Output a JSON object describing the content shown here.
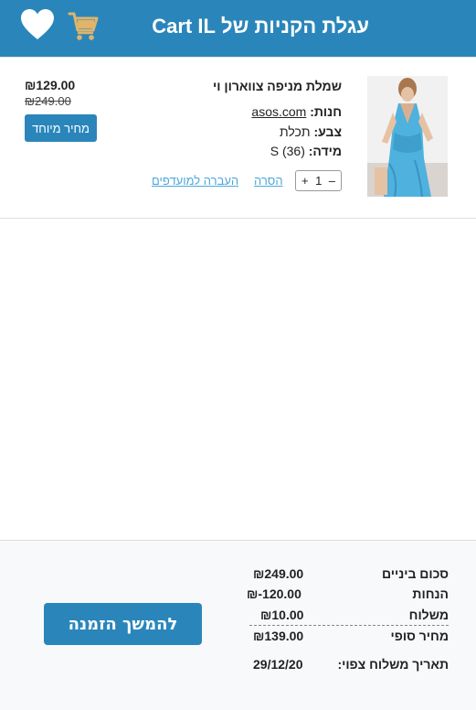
{
  "header": {
    "title": "עגלת הקניות של Cart IL",
    "heart_icon": "heart-icon",
    "cart_icon": "shopping-cart-icon",
    "background_color": "#2a86ba",
    "cart_icon_color": "#e0b46a"
  },
  "cart_item": {
    "name": "שמלת מניפה צווארון וי",
    "store_label": "חנות:",
    "store_value": "asos.com",
    "color_label": "צבע:",
    "color_value": "תכלת",
    "size_label": "מידה:",
    "size_value": "S (36)",
    "quantity": "1",
    "qty_plus": "+",
    "qty_minus": "–",
    "remove_label": "הסרה",
    "move_to_favorites_label": "העברה למועדפים",
    "price_current": "₪129.00",
    "price_old": "₪249.00",
    "special_price_label": "מחיר מיוחד"
  },
  "summary": {
    "subtotal_label": "סכום ביניים",
    "subtotal_value": "₪249.00",
    "discounts_label": "הנחות",
    "discounts_value": "₪-120.00",
    "shipping_label": "משלוח",
    "shipping_value": "₪10.00",
    "final_price_label": "מחיר סופי",
    "final_price_value": "₪139.00",
    "expected_delivery_label": "תאריך משלוח צפוי:",
    "expected_delivery_value": "29/12/20",
    "continue_button_label": "להמשך הזמנה"
  }
}
